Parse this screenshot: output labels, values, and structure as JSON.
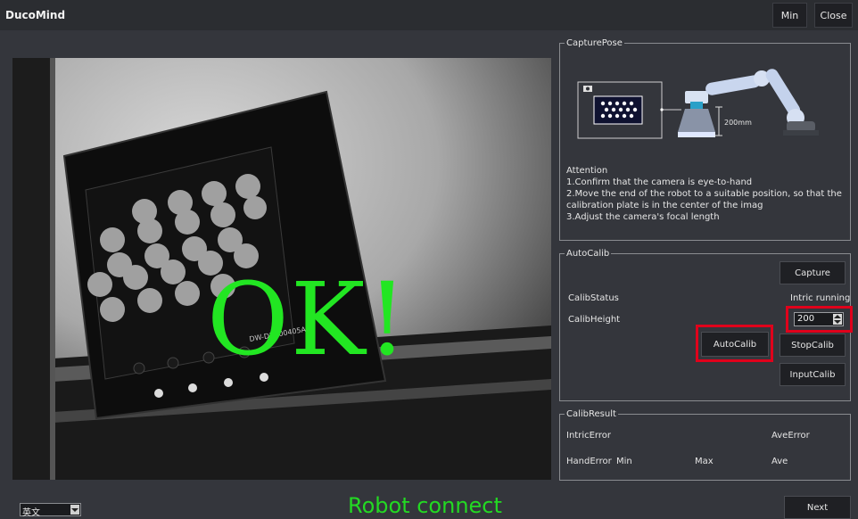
{
  "window": {
    "title": "DucoMind",
    "min_label": "Min",
    "close_label": "Close"
  },
  "camera": {
    "overlay_text": "OK!",
    "plate_label": "DW-DB200405A"
  },
  "capture_pose": {
    "title": "CapturePose",
    "distance_label": "200mm",
    "attention": {
      "heading": "Attention",
      "line1": "1.Confirm that the camera is eye-to-hand",
      "line2a": "2.Move the end of the robot to a suitable position, so that the",
      "line2b": "calibration plate is in the center of the imag",
      "line3": "3.Adjust the camera's focal length"
    }
  },
  "auto_calib": {
    "title": "AutoCalib",
    "capture_label": "Capture",
    "status_label": "CalibStatus",
    "status_value": "Intric running",
    "height_label": "CalibHeight",
    "height_value": "200",
    "autocalib_label": "AutoCalib",
    "stopcalib_label": "StopCalib",
    "inputcalib_label": "InputCalib"
  },
  "calib_result": {
    "title": "CalibResult",
    "intric_error_label": "IntricError",
    "ave_error_label": "AveError",
    "hand_error_label": "HandError",
    "min_label": "Min",
    "max_label": "Max",
    "ave_label": "Ave"
  },
  "footer": {
    "language_value": "英文",
    "status_text": "Robot connect",
    "next_label": "Next"
  },
  "colors": {
    "ok_green": "#22e622",
    "status_green": "#23d923",
    "highlight_red": "#e0001b",
    "background": "#34363c"
  },
  "icons": [
    "camera-icon",
    "robot-arm-icon",
    "calibration-plate-icon",
    "spin-up-icon",
    "spin-down-icon",
    "dropdown-arrow-icon"
  ]
}
